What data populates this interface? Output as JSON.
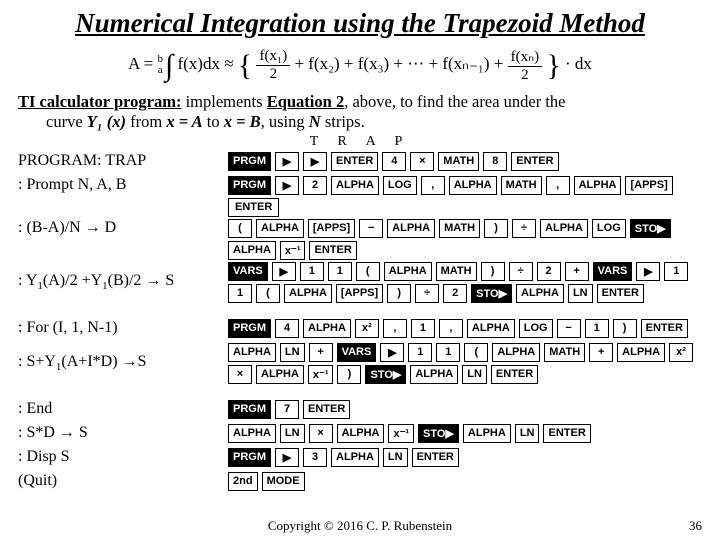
{
  "title": "Numerical Integration using the Trapezoid Method",
  "equation": {
    "lhs": "A =",
    "int_upper": "b",
    "int_lower": "a",
    "integrand": "f(x)dx ≈",
    "term1_num": "f(x₁)",
    "term1_den": "2",
    "mid": "+ f(x₂) + f(x₃) + ⋯ + f(xₙ₋₁) +",
    "termN_num": "f(xₙ)",
    "termN_den": "2",
    "tail": "· dx"
  },
  "intro": {
    "label": "TI calculator program:",
    "text1": " implements ",
    "eqref": "Equation 2",
    "text2": ", above, to find the area under the",
    "line2a": "curve  ",
    "y1x": "Y₁ (x)",
    "line2b": " from ",
    "xa": "x = A",
    "line2c": " to ",
    "xb": "x = B",
    "line2d": ", using ",
    "n": "N",
    "line2e": " strips."
  },
  "keyhint": "T R   A   P",
  "rows": [
    {
      "code": "PROGRAM: TRAP",
      "keys": [
        "PRGM|blk",
        "▶",
        "▶",
        "ENTER",
        "4",
        "×",
        "MATH",
        "8",
        "ENTER"
      ]
    },
    {
      "code": ": Prompt N, A, B",
      "keys": [
        "PRGM|blk",
        "▶",
        "2",
        "ALPHA",
        "LOG",
        ",",
        "ALPHA",
        "MATH",
        ",",
        "ALPHA",
        "[APPS]",
        "ENTER|wide"
      ]
    },
    {
      "code": ": (B-A)/N → D",
      "keys": [
        "(",
        "ALPHA",
        "[APPS]",
        "−",
        "ALPHA",
        "MATH",
        ")",
        "÷",
        "ALPHA",
        "LOG",
        "STO▶|blk",
        "ALPHA",
        "x⁻¹",
        "ENTER"
      ]
    },
    {
      "code": ": Y₁(A)/2 +Y₁(B)/2 → S",
      "tall": true,
      "keys": [
        "VARS|blk",
        "▶",
        "1",
        "1",
        "(",
        "ALPHA",
        "MATH",
        ")",
        "÷",
        "2",
        "+",
        "VARS|blk",
        "▶",
        "1",
        "1",
        "(",
        "ALPHA",
        "[APPS]",
        ")",
        "÷",
        "2",
        "STO▶|blk",
        "ALPHA",
        "LN",
        "ENTER"
      ]
    },
    {
      "spacer": true
    },
    {
      "code": ": For (I, 1, N-1)",
      "keys": [
        "PRGM|blk",
        "4",
        "ALPHA",
        "x²",
        ",",
        "1",
        ",",
        "ALPHA",
        "LOG",
        "−",
        "1",
        ")",
        "ENTER"
      ]
    },
    {
      "code": ": S+Y₁(A+I*D) →S",
      "tall": true,
      "keys": [
        "ALPHA",
        "LN",
        "+",
        "VARS|blk",
        "▶",
        "1",
        "1",
        "(",
        "ALPHA",
        "MATH",
        "+",
        "ALPHA",
        "x²",
        "×",
        "ALPHA",
        "x⁻¹",
        ")",
        "STO▶|blk",
        "ALPHA",
        "LN",
        "ENTER"
      ]
    },
    {
      "spacer": true
    },
    {
      "code": ": End",
      "keys": [
        "PRGM|blk",
        "7",
        "ENTER"
      ]
    },
    {
      "code": ": S*D →  S",
      "keys": [
        "ALPHA",
        "LN",
        "×",
        "ALPHA",
        "x⁻¹",
        "STO▶|blk",
        "ALPHA",
        "LN",
        "ENTER"
      ]
    },
    {
      "code": ": Disp S",
      "keys": [
        "PRGM|blk",
        "▶",
        "3",
        "ALPHA",
        "LN",
        "ENTER"
      ]
    },
    {
      "code": "(Quit)",
      "keys": [
        "2nd",
        "MODE"
      ]
    }
  ],
  "footer": {
    "copyright": "Copyright © 2016 C. P. Rubenstein",
    "page": "36"
  }
}
